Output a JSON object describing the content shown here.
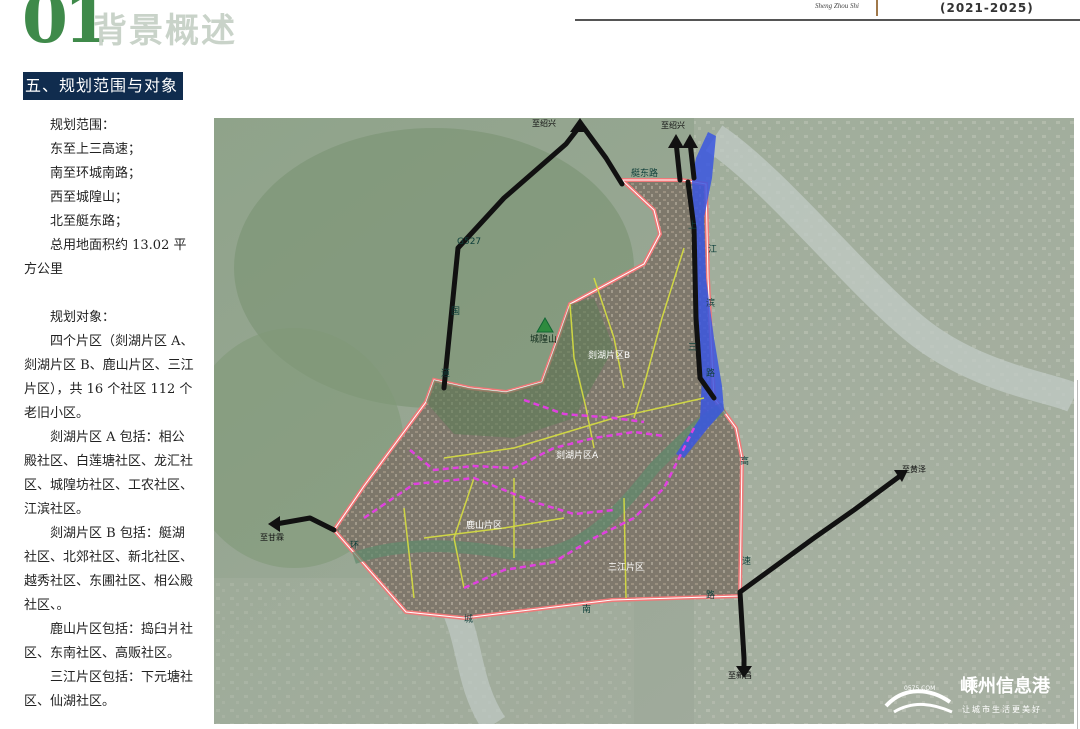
{
  "header": {
    "number": "01",
    "title": "背景概述",
    "city": "Sheng Zhou Shi",
    "period": "(2021-2025)"
  },
  "section": {
    "title": "五、规划范围与对象"
  },
  "scope": {
    "heading": "规划范围：",
    "lines": [
      "东至上三高速；",
      "南至环城南路；",
      "西至城隍山；",
      "北至艇东路；"
    ],
    "area": "总用地面积约 13.02 平方公里"
  },
  "objects": {
    "heading": "规划对象：",
    "summary": "四个片区（剡湖片区 A、剡湖片区 B、鹿山片区、三江片区），共 16 个社区 112 个老旧小区。",
    "items": [
      "剡湖片区 A 包括：相公殿社区、白莲塘社区、龙汇社区、城隍坊社区、工农社区、江滨社区。",
      "剡湖片区 B 包括：艇湖社区、北郊社区、新北社区、越秀社区、东圃社区、相公殿社区、。",
      "鹿山片区包括：捣臼爿社区、东南社区、高贩社区。",
      "三江片区包括：下元塘社区、仙湖社区。"
    ]
  },
  "map": {
    "directions": {
      "north_west": "至绍兴",
      "north_east": "至绍兴",
      "east": "至黄泽",
      "west": "至甘霖",
      "south": "至新昌"
    },
    "roads": {
      "g527": "G527",
      "guo": "国",
      "dao": "道",
      "ting_dong_lu": "艇东路",
      "shang": "上",
      "san": "三",
      "gao": "高",
      "su": "速",
      "jiang": "江",
      "bin": "滨",
      "lu_e": "路",
      "huan": "环",
      "cheng": "城",
      "nan": "南",
      "lu_s": "路"
    },
    "mountain": "城隍山",
    "districts": {
      "b": "剡湖片区B",
      "a": "剡湖片区A",
      "lushan": "鹿山片区",
      "sanjiang": "三江片区"
    },
    "colors": {
      "boundary": "#f07878",
      "route": "#111111",
      "river": "#3a56e0",
      "district_line": "#d8e040",
      "dashed": "#e040e0",
      "mountain": "#2e8b3e"
    },
    "watermark": {
      "site": "0575.COM",
      "name": "嵊州信息港",
      "slogan": "让城市生活更美好"
    }
  }
}
